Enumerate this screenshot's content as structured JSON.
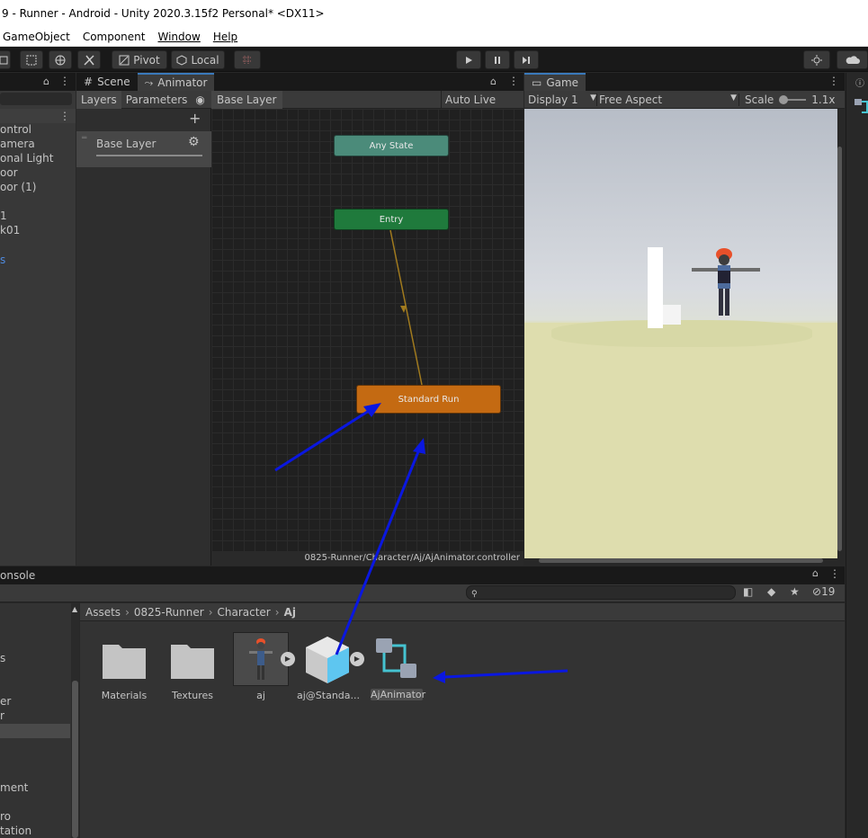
{
  "title": "9 - Runner - Android - Unity 2020.3.15f2 Personal* <DX11>",
  "menu": [
    "GameObject",
    "Component",
    "Window",
    "Help"
  ],
  "toolbar": {
    "pivot": "Pivot",
    "local": "Local"
  },
  "hierarchy": {
    "items": [
      "ontrol",
      "amera",
      "onal Light",
      "oor",
      "oor (1)",
      "1",
      "k01",
      "s"
    ]
  },
  "animator": {
    "tabs": {
      "scene": "Scene",
      "animator": "Animator"
    },
    "subtabs": {
      "layers": "Layers",
      "parameters": "Parameters"
    },
    "breadcrumb": "Base Layer",
    "auto_live_link": "Auto Live Link",
    "layer_name": "Base Layer",
    "nodes": {
      "any_state": "Any State",
      "entry": "Entry",
      "standard_run": "Standard Run"
    },
    "footer_path": "0825-Runner/Character/Aj/AjAnimator.controller"
  },
  "game": {
    "tab": "Game",
    "display": "Display 1",
    "aspect": "Free Aspect",
    "scale_label": "Scale",
    "scale_value": "1.1x"
  },
  "console_tab": "onsole",
  "project": {
    "breadcrumb": [
      "Assets",
      "0825-Runner",
      "Character",
      "Aj"
    ],
    "hidden_count": "19",
    "left_items": [
      "s",
      "er",
      "r",
      "ment",
      "ro",
      "tation"
    ],
    "assets": [
      {
        "name": "Materials"
      },
      {
        "name": "Textures"
      },
      {
        "name": "aj"
      },
      {
        "name": "aj@Standa..."
      },
      {
        "name": "AjAnimator"
      }
    ]
  },
  "colors": {
    "accent": "#3a79bb",
    "entry_node": "#1f7a3c",
    "any_state_node": "#4b8b7a",
    "run_node": "#c46a12",
    "arrow": "#0000ff",
    "transition": "#a07a1e"
  }
}
